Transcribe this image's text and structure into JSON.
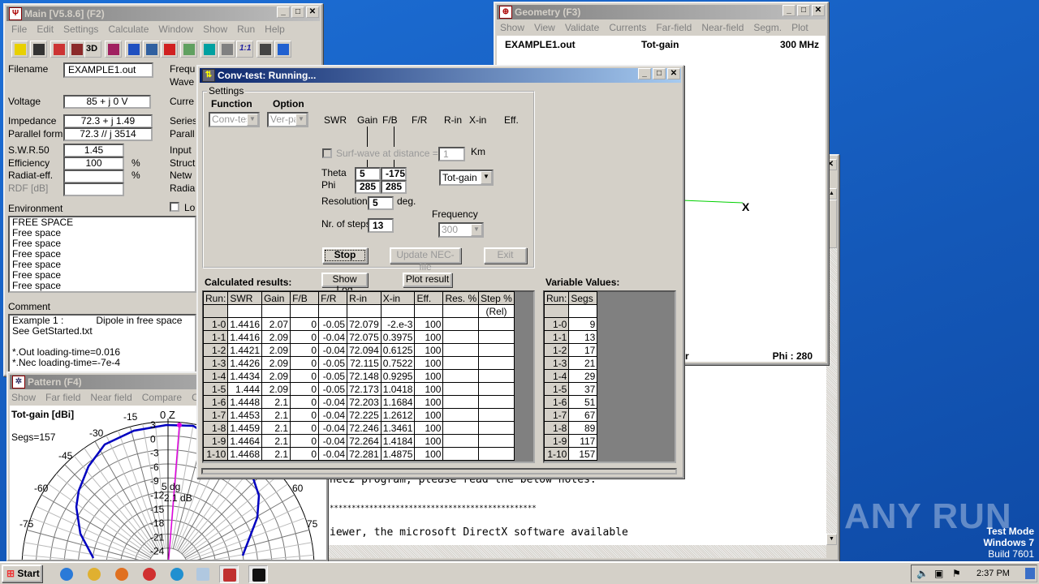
{
  "main": {
    "title": "Main [V5.8.6]  (F2)",
    "menu": [
      "File",
      "Edit",
      "Settings",
      "Calculate",
      "Window",
      "Show",
      "Run",
      "Help"
    ],
    "toolbar_icons": [
      "open-icon",
      "save-icon",
      "antenna-icon",
      "geometry-icon",
      "3d-icon",
      "edit-icon",
      "pattern-icon",
      "sweep-icon",
      "smith-icon",
      "optimize-icon",
      "calculator-icon",
      "matching-icon",
      "scale-icon",
      "book-icon",
      "help-icon"
    ],
    "toolbar_3d": "3D",
    "toolbar_scale": "1:1",
    "fields": {
      "filename_label": "Filename",
      "filename": "EXAMPLE1.out",
      "voltage_label": "Voltage",
      "voltage": "85 + j 0 V",
      "impedance_label": "Impedance",
      "impedance": "72.3 + j 1.49",
      "parallel_label": "Parallel form",
      "parallel": "72.3 // j 3514",
      "swr_label": "S.W.R.50",
      "swr": "1.45",
      "efficiency_label": "Efficiency",
      "efficiency": "100",
      "pct": "%",
      "radiat_label": "Radiat-eff.",
      "radiat": "",
      "rdf_label": "RDF [dB]",
      "rdf": ""
    },
    "right_labels": [
      "Frequ",
      "Wave",
      "Curre",
      "Series",
      "Parall",
      "Input",
      "Struct",
      "Netw",
      "Radia"
    ],
    "lo_label": "Lo",
    "environment_label": "Environment",
    "environment": [
      "FREE SPACE",
      "Free space",
      "Free space",
      "Free space",
      "Free space",
      "Free space",
      "Free space"
    ],
    "comment_label": "Comment",
    "comment": [
      "Example 1 :            Dipole in free space",
      "See GetStarted.txt",
      "",
      "*.Out loading-time=0.016",
      "*.Nec loading-time=-7e-4"
    ]
  },
  "pattern": {
    "title": "Pattern   (F4)",
    "menu": [
      "Show",
      "Far field",
      "Near field",
      "Compare",
      "Ope"
    ],
    "heading": "Tot-gain [dBi]",
    "segs": "Segs=157",
    "zenith": "0  Z",
    "angle_labels": [
      "-15",
      "-30",
      "-45",
      "-60",
      "-75",
      "60",
      "75"
    ],
    "ring_labels": [
      "3",
      "0",
      "-3",
      "-6",
      "-9",
      "-12",
      "-15",
      "-18",
      "-21",
      "-24"
    ],
    "marker_angle": "5 dg",
    "marker_gain": "2.1 dB",
    "curve_color": "#0000c0",
    "marker_color": "#e000e0"
  },
  "geometry": {
    "title": "Geometry   (F3)",
    "menu": [
      "Show",
      "View",
      "Validate",
      "Currents",
      "Far-field",
      "Near-field",
      "Segm.",
      "Plot"
    ],
    "file": "EXAMPLE1.out",
    "mode": "Tot-gain",
    "freq": "300 MHz",
    "bottom_left": "tr",
    "phi": "Phi : 280"
  },
  "viewer": {
    "lines": [
      "nec2 program, please read the below notes.",
      "***********************************************",
      "iewer, the microsoft DirectX software available"
    ]
  },
  "conv": {
    "title": "Conv-test: Running...",
    "settings_label": "Settings",
    "function_label": "Function",
    "function_value": "Conv-tes",
    "option_label": "Option",
    "option_value": "Ver-pa",
    "col_heads": [
      "SWR",
      "Gain",
      "F/B",
      "F/R",
      "R-in",
      "X-in",
      "Eff."
    ],
    "surf_label": "Surf-wave at distance =",
    "surf_value": "1",
    "km": "Km",
    "theta_label": "Theta",
    "phi_label": "Phi",
    "theta1": "5",
    "theta2": "-175",
    "phi1": "285",
    "phi2": "285",
    "gain_select": "Tot-gain",
    "resolution_label": "Resolution",
    "resolution": "5",
    "deg": "deg.",
    "frequency_label": "Frequency",
    "frequency": "300",
    "steps_label": "Nr. of steps",
    "steps": "13",
    "stop": "Stop",
    "update": "Update NEC-file",
    "exit": "Exit",
    "results_label": "Calculated results:",
    "show_log": "Show Log",
    "plot_result": "Plot result",
    "results_headers": [
      "Run:",
      "SWR",
      "Gain",
      "F/B",
      "F/R",
      "R-in",
      "X-in",
      "Eff.",
      "Res. %",
      "Step %"
    ],
    "results_sub": [
      "",
      "",
      "",
      "",
      "",
      "",
      "",
      "",
      "",
      "(Rel)"
    ],
    "results": [
      [
        "1-0",
        "1.4416",
        "2.07",
        "0",
        "-0.05",
        "72.079",
        "-2.e-3",
        "100",
        "",
        ""
      ],
      [
        "1-1",
        "1.4416",
        "2.09",
        "0",
        "-0.04",
        "72.075",
        "0.3975",
        "100",
        "",
        ""
      ],
      [
        "1-2",
        "1.4421",
        "2.09",
        "0",
        "-0.04",
        "72.094",
        "0.6125",
        "100",
        "",
        ""
      ],
      [
        "1-3",
        "1.4426",
        "2.09",
        "0",
        "-0.05",
        "72.115",
        "0.7522",
        "100",
        "",
        ""
      ],
      [
        "1-4",
        "1.4434",
        "2.09",
        "0",
        "-0.05",
        "72.148",
        "0.9295",
        "100",
        "",
        ""
      ],
      [
        "1-5",
        "1.444",
        "2.09",
        "0",
        "-0.05",
        "72.173",
        "1.0418",
        "100",
        "",
        ""
      ],
      [
        "1-6",
        "1.4448",
        "2.1",
        "0",
        "-0.04",
        "72.203",
        "1.1684",
        "100",
        "",
        ""
      ],
      [
        "1-7",
        "1.4453",
        "2.1",
        "0",
        "-0.04",
        "72.225",
        "1.2612",
        "100",
        "",
        ""
      ],
      [
        "1-8",
        "1.4459",
        "2.1",
        "0",
        "-0.04",
        "72.246",
        "1.3461",
        "100",
        "",
        ""
      ],
      [
        "1-9",
        "1.4464",
        "2.1",
        "0",
        "-0.04",
        "72.264",
        "1.4184",
        "100",
        "",
        ""
      ],
      [
        "1-10",
        "1.4468",
        "2.1",
        "0",
        "-0.04",
        "72.281",
        "1.4875",
        "100",
        "",
        ""
      ]
    ],
    "vars_label": "Variable Values:",
    "vars_headers": [
      "Run:",
      "Segs"
    ],
    "vars": [
      [
        "1-0",
        "9"
      ],
      [
        "1-1",
        "13"
      ],
      [
        "1-2",
        "17"
      ],
      [
        "1-3",
        "21"
      ],
      [
        "1-4",
        "29"
      ],
      [
        "1-5",
        "37"
      ],
      [
        "1-6",
        "51"
      ],
      [
        "1-7",
        "67"
      ],
      [
        "1-8",
        "89"
      ],
      [
        "1-9",
        "117"
      ],
      [
        "1-10",
        "157"
      ]
    ]
  },
  "watermark": {
    "text": "ANY RUN",
    "line1": "Test Mode",
    "line2": "Windows 7",
    "line3": "Build 7601"
  },
  "taskbar": {
    "start": "Start",
    "apps": [
      "ie-icon",
      "explorer-icon",
      "media-player-icon",
      "chrome-icon",
      "edge-icon",
      "notepad-icon",
      "4nec2-icon",
      "cmd-icon"
    ],
    "clock": "2:37 PM"
  }
}
